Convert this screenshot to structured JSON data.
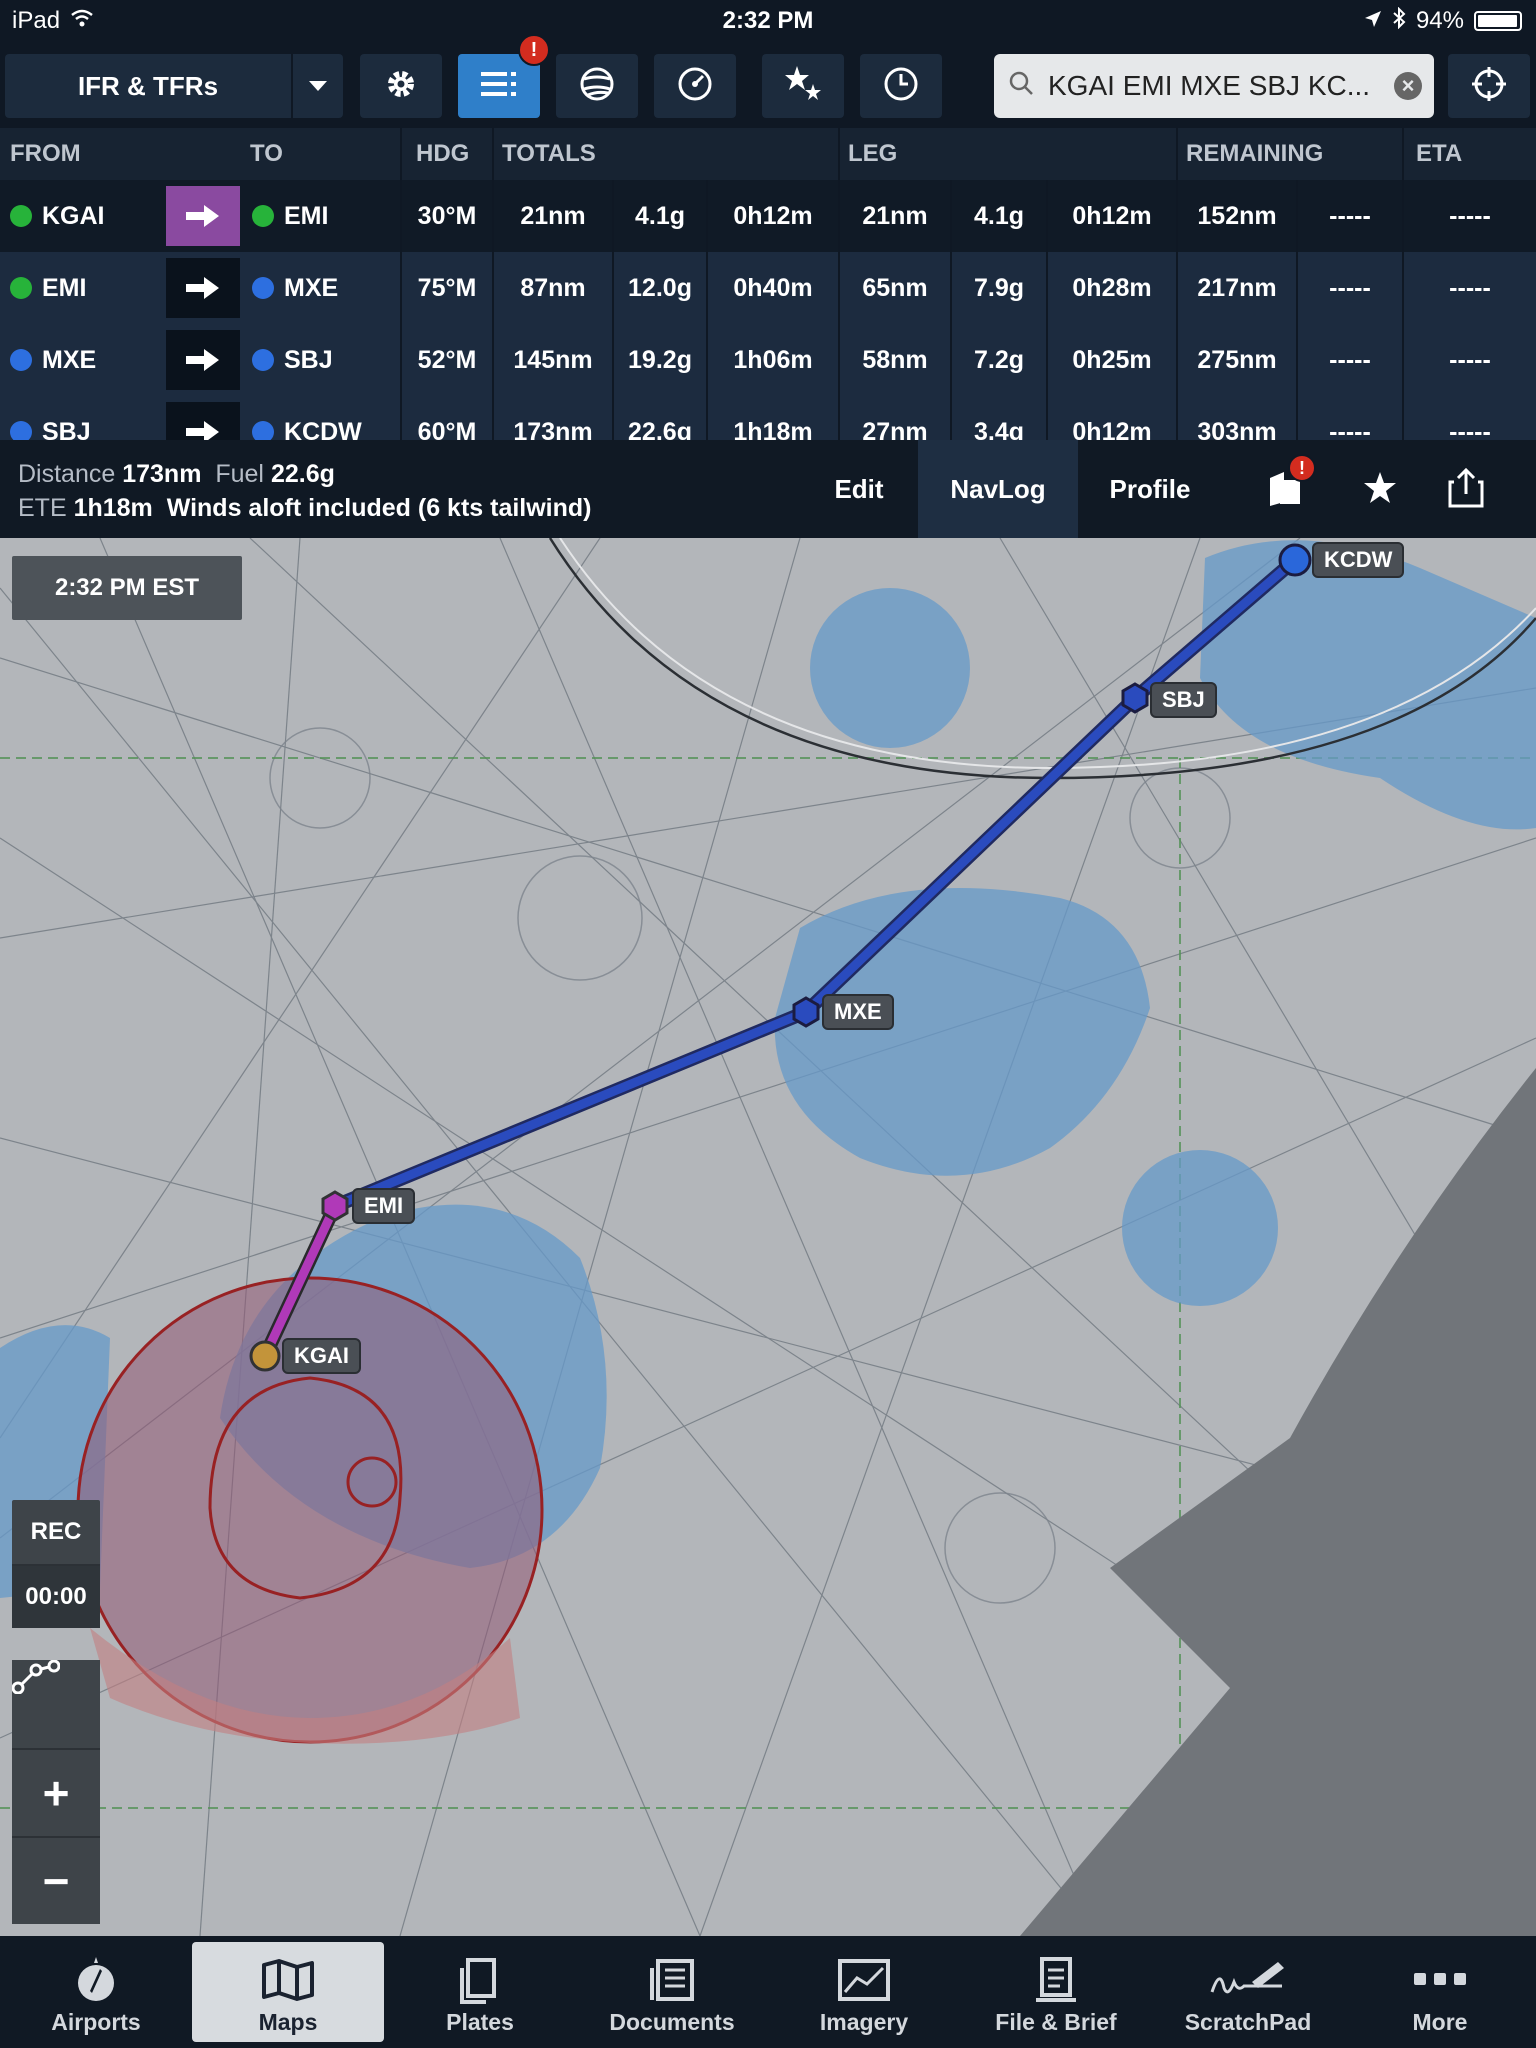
{
  "status_bar": {
    "device": "iPad",
    "time": "2:32 PM",
    "battery": "94%"
  },
  "toolbar": {
    "layer": "IFR & TFRs",
    "notification_badge": "!",
    "search_text": "KGAI EMI MXE SBJ KC..."
  },
  "navlog": {
    "headers": {
      "from": "FROM",
      "to": "TO",
      "hdg": "HDG",
      "totals": "TOTALS",
      "leg": "LEG",
      "remaining": "REMAINING",
      "eta": "ETA"
    },
    "rows": [
      {
        "from": "KGAI",
        "to": "EMI",
        "hdg": "30°M",
        "t_dist": "21nm",
        "t_fuel": "4.1g",
        "t_time": "0h12m",
        "l_dist": "21nm",
        "l_fuel": "4.1g",
        "l_time": "0h12m",
        "remaining": "152nm",
        "rem2": "-----",
        "eta": "-----",
        "from_color": "#27b33a",
        "to_color": "#27b33a"
      },
      {
        "from": "EMI",
        "to": "MXE",
        "hdg": "75°M",
        "t_dist": "87nm",
        "t_fuel": "12.0g",
        "t_time": "0h40m",
        "l_dist": "65nm",
        "l_fuel": "7.9g",
        "l_time": "0h28m",
        "remaining": "217nm",
        "rem2": "-----",
        "eta": "-----",
        "from_color": "#27b33a",
        "to_color": "#2d6fe0"
      },
      {
        "from": "MXE",
        "to": "SBJ",
        "hdg": "52°M",
        "t_dist": "145nm",
        "t_fuel": "19.2g",
        "t_time": "1h06m",
        "l_dist": "58nm",
        "l_fuel": "7.2g",
        "l_time": "0h25m",
        "remaining": "275nm",
        "rem2": "-----",
        "eta": "-----",
        "from_color": "#2d6fe0",
        "to_color": "#2d6fe0"
      },
      {
        "from": "SBJ",
        "to": "KCDW",
        "hdg": "60°M",
        "t_dist": "173nm",
        "t_fuel": "22.6g",
        "t_time": "1h18m",
        "l_dist": "27nm",
        "l_fuel": "3.4g",
        "l_time": "0h12m",
        "remaining": "303nm",
        "rem2": "-----",
        "eta": "-----",
        "from_color": "#2d6fe0",
        "to_color": "#2d6fe0"
      }
    ]
  },
  "summary": {
    "distance_label": "Distance",
    "distance_value": "173nm",
    "fuel_label": "Fuel",
    "fuel_value": "22.6g",
    "ete_label": "ETE",
    "ete_value": "1h18m",
    "winds_note": "Winds aloft included (6 kts tailwind)",
    "tabs": {
      "edit": "Edit",
      "navlog": "NavLog",
      "profile": "Profile"
    },
    "badge": "!"
  },
  "map": {
    "time_chip": "2:32 PM EST",
    "rec_label": "REC",
    "rec_timer": "00:00",
    "zoom_in": "+",
    "zoom_out": "−",
    "waypoints": {
      "kgai": "KGAI",
      "emi": "EMI",
      "mxe": "MXE",
      "sbj": "SBJ",
      "kcdw": "KCDW"
    },
    "colors": {
      "route_active": "#c33bc9",
      "route": "#2b4fd0",
      "airspace": "#6fa8dc",
      "restricted": "#b83a3a"
    }
  },
  "tabbar": {
    "tabs": [
      {
        "label": "Airports",
        "icon": "airport-compass-icon"
      },
      {
        "label": "Maps",
        "icon": "map-icon"
      },
      {
        "label": "Plates",
        "icon": "plates-icon"
      },
      {
        "label": "Documents",
        "icon": "documents-icon"
      },
      {
        "label": "Imagery",
        "icon": "imagery-icon"
      },
      {
        "label": "File & Brief",
        "icon": "file-brief-icon"
      },
      {
        "label": "ScratchPad",
        "icon": "scratchpad-icon"
      },
      {
        "label": "More",
        "icon": "more-dots-icon"
      }
    ]
  }
}
